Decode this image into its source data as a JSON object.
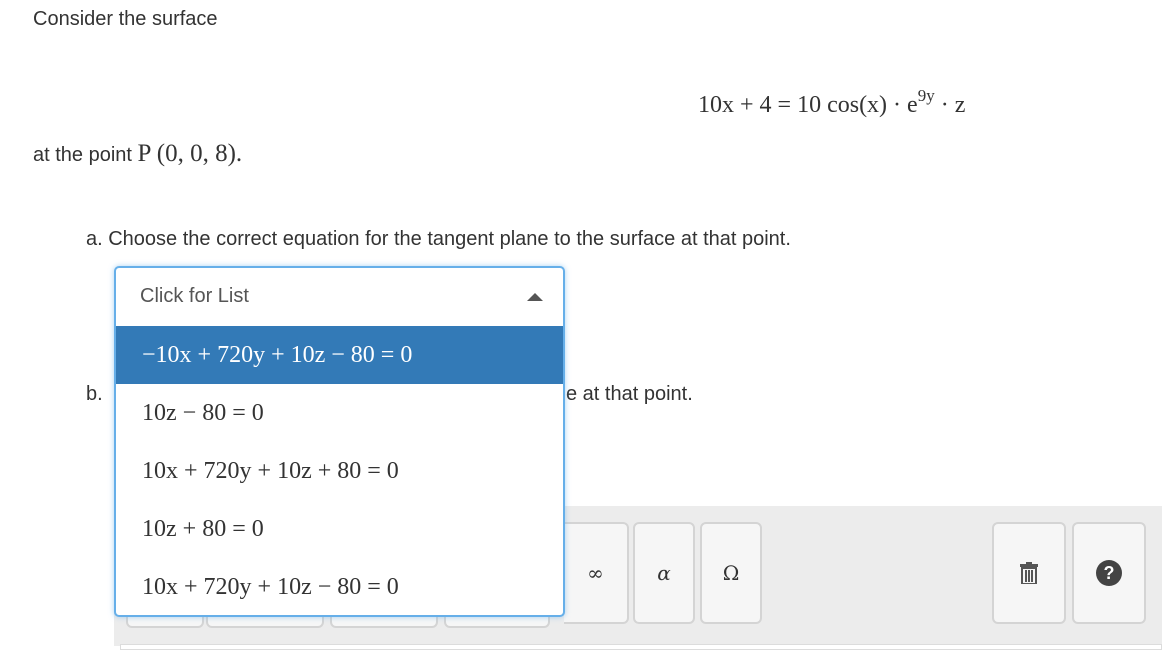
{
  "problem": {
    "intro": "Consider the surface",
    "equation": {
      "lhs": "10x + 4 = 10 cos(x) · e",
      "exponent": "9y",
      "tail": " · z"
    },
    "point_prefix": "at the point ",
    "point_math": "P (0, 0, 8).",
    "part_a": "a. Choose the correct equation for the tangent plane to the surface at that point.",
    "part_b_prefix": "b.",
    "part_b_suffix": "e at that point."
  },
  "dropdown": {
    "placeholder": "Click for List",
    "options": [
      "−10x + 720y + 10z − 80 = 0",
      "10z − 80 = 0",
      "10x + 720y + 10z + 80 = 0",
      "10z + 80 = 0",
      "10x + 720y + 10z − 80 = 0"
    ],
    "selected_index": 0
  },
  "toolbar": {
    "infinity": "∞",
    "alpha": "α",
    "omega": "Ω",
    "help": "?"
  },
  "colors": {
    "accent": "#337ab7",
    "focus_border": "#66afe9",
    "toolbar_bg": "#ececec"
  }
}
